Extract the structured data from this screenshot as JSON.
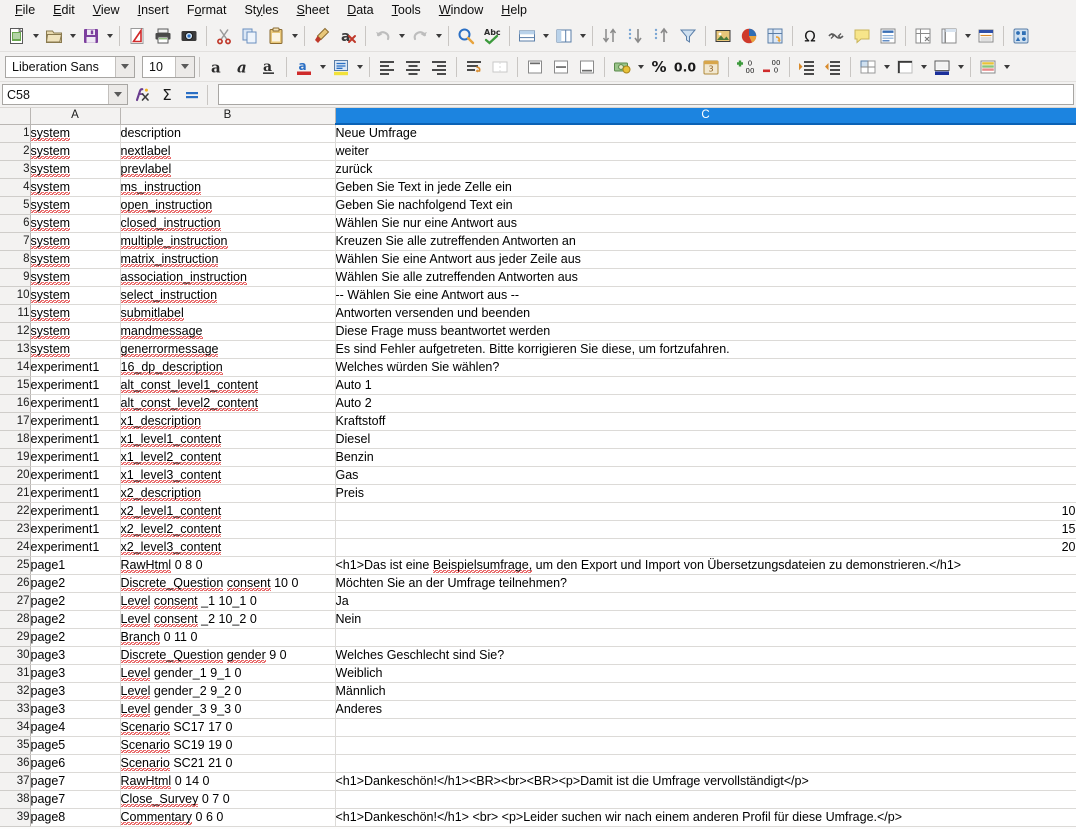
{
  "app": {
    "name": "LibreOffice Calc",
    "font_family_value": "Liberation Sans",
    "font_size_value": "10"
  },
  "menubar": {
    "items": [
      {
        "label": "File",
        "accel": "F"
      },
      {
        "label": "Edit",
        "accel": "E"
      },
      {
        "label": "View",
        "accel": "V"
      },
      {
        "label": "Insert",
        "accel": "I"
      },
      {
        "label": "Format",
        "accel": "o"
      },
      {
        "label": "Styles",
        "accel": "y"
      },
      {
        "label": "Sheet",
        "accel": "S"
      },
      {
        "label": "Data",
        "accel": "D"
      },
      {
        "label": "Tools",
        "accel": "T"
      },
      {
        "label": "Window",
        "accel": "W"
      },
      {
        "label": "Help",
        "accel": "H"
      }
    ]
  },
  "standard_toolbar": {
    "items": [
      {
        "name": "new-document-icon",
        "tooltip": "New",
        "dropdown": true
      },
      {
        "name": "open-folder-icon",
        "tooltip": "Open",
        "dropdown": true
      },
      {
        "name": "save-icon",
        "tooltip": "Save",
        "dropdown": true
      },
      {
        "name": "separator"
      },
      {
        "name": "export-pdf-icon",
        "tooltip": "Export as PDF"
      },
      {
        "name": "print-icon",
        "tooltip": "Print"
      },
      {
        "name": "print-preview-icon",
        "tooltip": "Toggle Print Preview"
      },
      {
        "name": "separator"
      },
      {
        "name": "cut-scissors-icon",
        "tooltip": "Cut"
      },
      {
        "name": "copy-icon",
        "tooltip": "Copy"
      },
      {
        "name": "paste-clipboard-icon",
        "tooltip": "Paste",
        "dropdown": true
      },
      {
        "name": "separator"
      },
      {
        "name": "clone-formatting-brush-icon",
        "tooltip": "Clone Formatting"
      },
      {
        "name": "clear-formatting-icon",
        "tooltip": "Clear Direct Formatting"
      },
      {
        "name": "separator"
      },
      {
        "name": "undo-icon",
        "tooltip": "Undo",
        "dropdown": true,
        "disabled": true
      },
      {
        "name": "redo-icon",
        "tooltip": "Redo",
        "dropdown": true,
        "disabled": true
      },
      {
        "name": "separator"
      },
      {
        "name": "find-replace-icon",
        "tooltip": "Find and Replace"
      },
      {
        "name": "spelling-icon",
        "tooltip": "Spelling"
      },
      {
        "name": "separator"
      },
      {
        "name": "row-icon",
        "tooltip": "Row",
        "dropdown": true
      },
      {
        "name": "column-icon",
        "tooltip": "Column",
        "dropdown": true
      },
      {
        "name": "separator"
      },
      {
        "name": "sort-icon",
        "tooltip": "Sort"
      },
      {
        "name": "sort-ascending-icon",
        "tooltip": "Sort Ascending"
      },
      {
        "name": "sort-descending-icon",
        "tooltip": "Sort Descending"
      },
      {
        "name": "autofilter-icon",
        "tooltip": "AutoFilter"
      },
      {
        "name": "separator"
      },
      {
        "name": "insert-image-icon",
        "tooltip": "Insert Image"
      },
      {
        "name": "insert-chart-icon",
        "tooltip": "Insert Chart"
      },
      {
        "name": "pivot-table-icon",
        "tooltip": "Insert or Edit Pivot Table"
      },
      {
        "name": "separator"
      },
      {
        "name": "special-character-icon",
        "tooltip": "Insert Special Character"
      },
      {
        "name": "hyperlink-icon",
        "tooltip": "Insert Hyperlink"
      },
      {
        "name": "comment-icon",
        "tooltip": "Insert Comment"
      },
      {
        "name": "headers-footers-icon",
        "tooltip": "Headers and Footers"
      },
      {
        "name": "separator"
      },
      {
        "name": "freeze-rows-columns-icon",
        "tooltip": "Freeze Rows and Columns"
      },
      {
        "name": "split-window-icon",
        "tooltip": "Split Window",
        "dropdown": true
      },
      {
        "name": "define-print-area-icon",
        "tooltip": "Define Print Area"
      },
      {
        "name": "separator"
      },
      {
        "name": "show-draw-functions-icon",
        "tooltip": "Show Draw Functions"
      }
    ]
  },
  "formatting_toolbar": {
    "font_name_placeholder": "Font Name",
    "font_size_placeholder": "Font Size",
    "items": [
      {
        "name": "bold-icon",
        "label": "a",
        "tooltip": "Bold"
      },
      {
        "name": "italic-icon",
        "label": "a",
        "tooltip": "Italic"
      },
      {
        "name": "underline-icon",
        "label": "a",
        "tooltip": "Underline"
      },
      {
        "name": "font-color-icon",
        "tooltip": "Font Color",
        "dropdown": true
      },
      {
        "name": "highlighting-color-icon",
        "tooltip": "Highlighting Color",
        "dropdown": true
      },
      {
        "name": "align-left-icon",
        "tooltip": "Align Left"
      },
      {
        "name": "align-center-icon",
        "tooltip": "Align Center"
      },
      {
        "name": "align-right-icon",
        "tooltip": "Align Right"
      },
      {
        "name": "wrap-text-icon",
        "tooltip": "Wrap Text"
      },
      {
        "name": "merge-cells-icon",
        "tooltip": "Merge Cells",
        "disabled": true
      },
      {
        "name": "align-top-icon",
        "tooltip": "Align Top"
      },
      {
        "name": "center-vertically-icon",
        "tooltip": "Center Vertically"
      },
      {
        "name": "align-bottom-icon",
        "tooltip": "Align Bottom"
      },
      {
        "name": "currency-format-icon",
        "tooltip": "Format as Currency",
        "dropdown": true
      },
      {
        "name": "percent-format-icon",
        "label": "%",
        "tooltip": "Format as Percent"
      },
      {
        "name": "number-format-icon",
        "label": "0.0",
        "tooltip": "Format as Number"
      },
      {
        "name": "date-format-icon",
        "tooltip": "Format as Date"
      },
      {
        "name": "add-decimal-place-icon",
        "tooltip": "Add Decimal Place"
      },
      {
        "name": "delete-decimal-place-icon",
        "tooltip": "Delete Decimal Place"
      },
      {
        "name": "increase-indent-icon",
        "tooltip": "Increase Indent"
      },
      {
        "name": "decrease-indent-icon",
        "tooltip": "Decrease Indent"
      },
      {
        "name": "borders-icon",
        "tooltip": "Borders",
        "dropdown": true
      },
      {
        "name": "border-style-icon",
        "tooltip": "Border Style",
        "dropdown": true
      },
      {
        "name": "background-color-icon",
        "tooltip": "Background Color",
        "dropdown": true
      },
      {
        "name": "conditional-formatting-icon",
        "tooltip": "Conditional",
        "dropdown": true
      }
    ]
  },
  "formula_bar": {
    "name_box_value": "C58",
    "name_box_placeholder": "Name Box",
    "function_wizard": "function-wizard-icon",
    "sum_icon": "sum-sigma-icon",
    "formula_icon": "formula-equals-icon",
    "input_line_value": "",
    "input_line_placeholder": ""
  },
  "sheet": {
    "selected_column": "C",
    "selection_color": "#1c84e0",
    "columns": [
      {
        "id": "A",
        "label": "A",
        "selected": false
      },
      {
        "id": "B",
        "label": "B",
        "selected": false
      },
      {
        "id": "C",
        "label": "C",
        "selected": true
      }
    ],
    "rows": [
      {
        "n": "1",
        "a": "system",
        "b": "description",
        "c": "Neue Umfrage",
        "num": false
      },
      {
        "n": "2",
        "a": "system",
        "b": "nextlabel",
        "c": "weiter",
        "num": false
      },
      {
        "n": "3",
        "a": "system",
        "b": "prevlabel",
        "c": "zurück",
        "num": false
      },
      {
        "n": "4",
        "a": "system",
        "b": "ms_instruction",
        "c": "Geben Sie Text in jede Zelle ein",
        "num": false
      },
      {
        "n": "5",
        "a": "system",
        "b": "open_instruction",
        "c": "Geben Sie nachfolgend Text ein",
        "num": false
      },
      {
        "n": "6",
        "a": "system",
        "b": "closed_instruction",
        "c": "Wählen Sie nur eine Antwort aus",
        "num": false
      },
      {
        "n": "7",
        "a": "system",
        "b": "multiple_instruction",
        "c": "Kreuzen Sie alle zutreffenden Antworten an",
        "num": false
      },
      {
        "n": "8",
        "a": "system",
        "b": "matrix_instruction",
        "c": "Wählen Sie eine Antwort aus jeder Zeile aus",
        "num": false
      },
      {
        "n": "9",
        "a": "system",
        "b": "association_instruction",
        "c": "Wählen Sie alle zutreffenden Antworten aus",
        "num": false
      },
      {
        "n": "10",
        "a": "system",
        "b": "select_instruction",
        "c": "-- Wählen Sie eine Antwort aus --",
        "num": false
      },
      {
        "n": "11",
        "a": "system",
        "b": "submitlabel",
        "c": "Antworten versenden und beenden",
        "num": false
      },
      {
        "n": "12",
        "a": "system",
        "b": "mandmessage",
        "c": "Diese Frage muss beantwortet werden",
        "num": false
      },
      {
        "n": "13",
        "a": "system",
        "b": "generrormessage",
        "c": "Es sind Fehler aufgetreten. Bitte korrigieren Sie diese, um fortzufahren.",
        "num": false
      },
      {
        "n": "14",
        "a": "experiment1",
        "b": "16_dp_description",
        "c": "Welches würden Sie wählen?",
        "num": false
      },
      {
        "n": "15",
        "a": "experiment1",
        "b": "alt_const_level1_content",
        "c": "Auto 1",
        "num": false
      },
      {
        "n": "16",
        "a": "experiment1",
        "b": "alt_const_level2_content",
        "c": "Auto 2",
        "num": false
      },
      {
        "n": "17",
        "a": "experiment1",
        "b": "x1_description",
        "c": "Kraftstoff",
        "num": false
      },
      {
        "n": "18",
        "a": "experiment1",
        "b": "x1_level1_content",
        "c": "Diesel",
        "num": false
      },
      {
        "n": "19",
        "a": "experiment1",
        "b": "x1_level2_content",
        "c": "Benzin",
        "num": false
      },
      {
        "n": "20",
        "a": "experiment1",
        "b": "x1_level3_content",
        "c": "Gas",
        "num": false
      },
      {
        "n": "21",
        "a": "experiment1",
        "b": "x2_description",
        "c": "Preis",
        "num": false
      },
      {
        "n": "22",
        "a": "experiment1",
        "b": "x2_level1_content",
        "c": "10",
        "num": true
      },
      {
        "n": "23",
        "a": "experiment1",
        "b": "x2_level2_content",
        "c": "15",
        "num": true
      },
      {
        "n": "24",
        "a": "experiment1",
        "b": "x2_level3_content",
        "c": "20",
        "num": true
      },
      {
        "n": "25",
        "a": "page1",
        "b": "RawHtml 0 8 0",
        "c": "<h1>Das ist eine Beispielsumfrage, um den Export und Import von Übersetzungsdateien zu demonstrieren.</h1>",
        "num": false
      },
      {
        "n": "26",
        "a": "page2",
        "b": "Discrete_Question consent  10 0",
        "c": "Möchten Sie an der Umfrage teilnehmen?",
        "num": false
      },
      {
        "n": "27",
        "a": "page2",
        "b": "Level consent _1 10_1 0",
        "c": "Ja",
        "num": false
      },
      {
        "n": "28",
        "a": "page2",
        "b": "Level consent _2 10_2 0",
        "c": "Nein",
        "num": false
      },
      {
        "n": "29",
        "a": "page2",
        "b": "Branch 0 11 0",
        "c": "",
        "num": false
      },
      {
        "n": "30",
        "a": "page3",
        "b": "Discrete_Question gender 9 0",
        "c": "Welches Geschlecht sind Sie?",
        "num": false
      },
      {
        "n": "31",
        "a": "page3",
        "b": "Level gender_1 9_1 0",
        "c": "Weiblich",
        "num": false
      },
      {
        "n": "32",
        "a": "page3",
        "b": "Level gender_2 9_2 0",
        "c": "Männlich",
        "num": false
      },
      {
        "n": "33",
        "a": "page3",
        "b": "Level gender_3 9_3 0",
        "c": "Anderes",
        "num": false
      },
      {
        "n": "34",
        "a": "page4",
        "b": "Scenario SC17 17 0",
        "c": "",
        "num": false
      },
      {
        "n": "35",
        "a": "page5",
        "b": "Scenario SC19 19 0",
        "c": "",
        "num": false
      },
      {
        "n": "36",
        "a": "page6",
        "b": "Scenario SC21 21 0",
        "c": "",
        "num": false
      },
      {
        "n": "37",
        "a": "page7",
        "b": "RawHtml 0 14 0",
        "c": "<h1>Dankeschön!</h1><BR><br><BR><p>Damit ist die Umfrage vervollständigt</p>",
        "num": false
      },
      {
        "n": "38",
        "a": "page7",
        "b": "Close_Survey 0 7 0",
        "c": "",
        "num": false
      },
      {
        "n": "39",
        "a": "page8",
        "b": "Commentary 0 6 0",
        "c": "<h1>Dankeschön!</h1> <br> <p>Leider suchen wir nach einem anderen Profil für diese Umfrage.</p>",
        "num": false
      }
    ]
  }
}
